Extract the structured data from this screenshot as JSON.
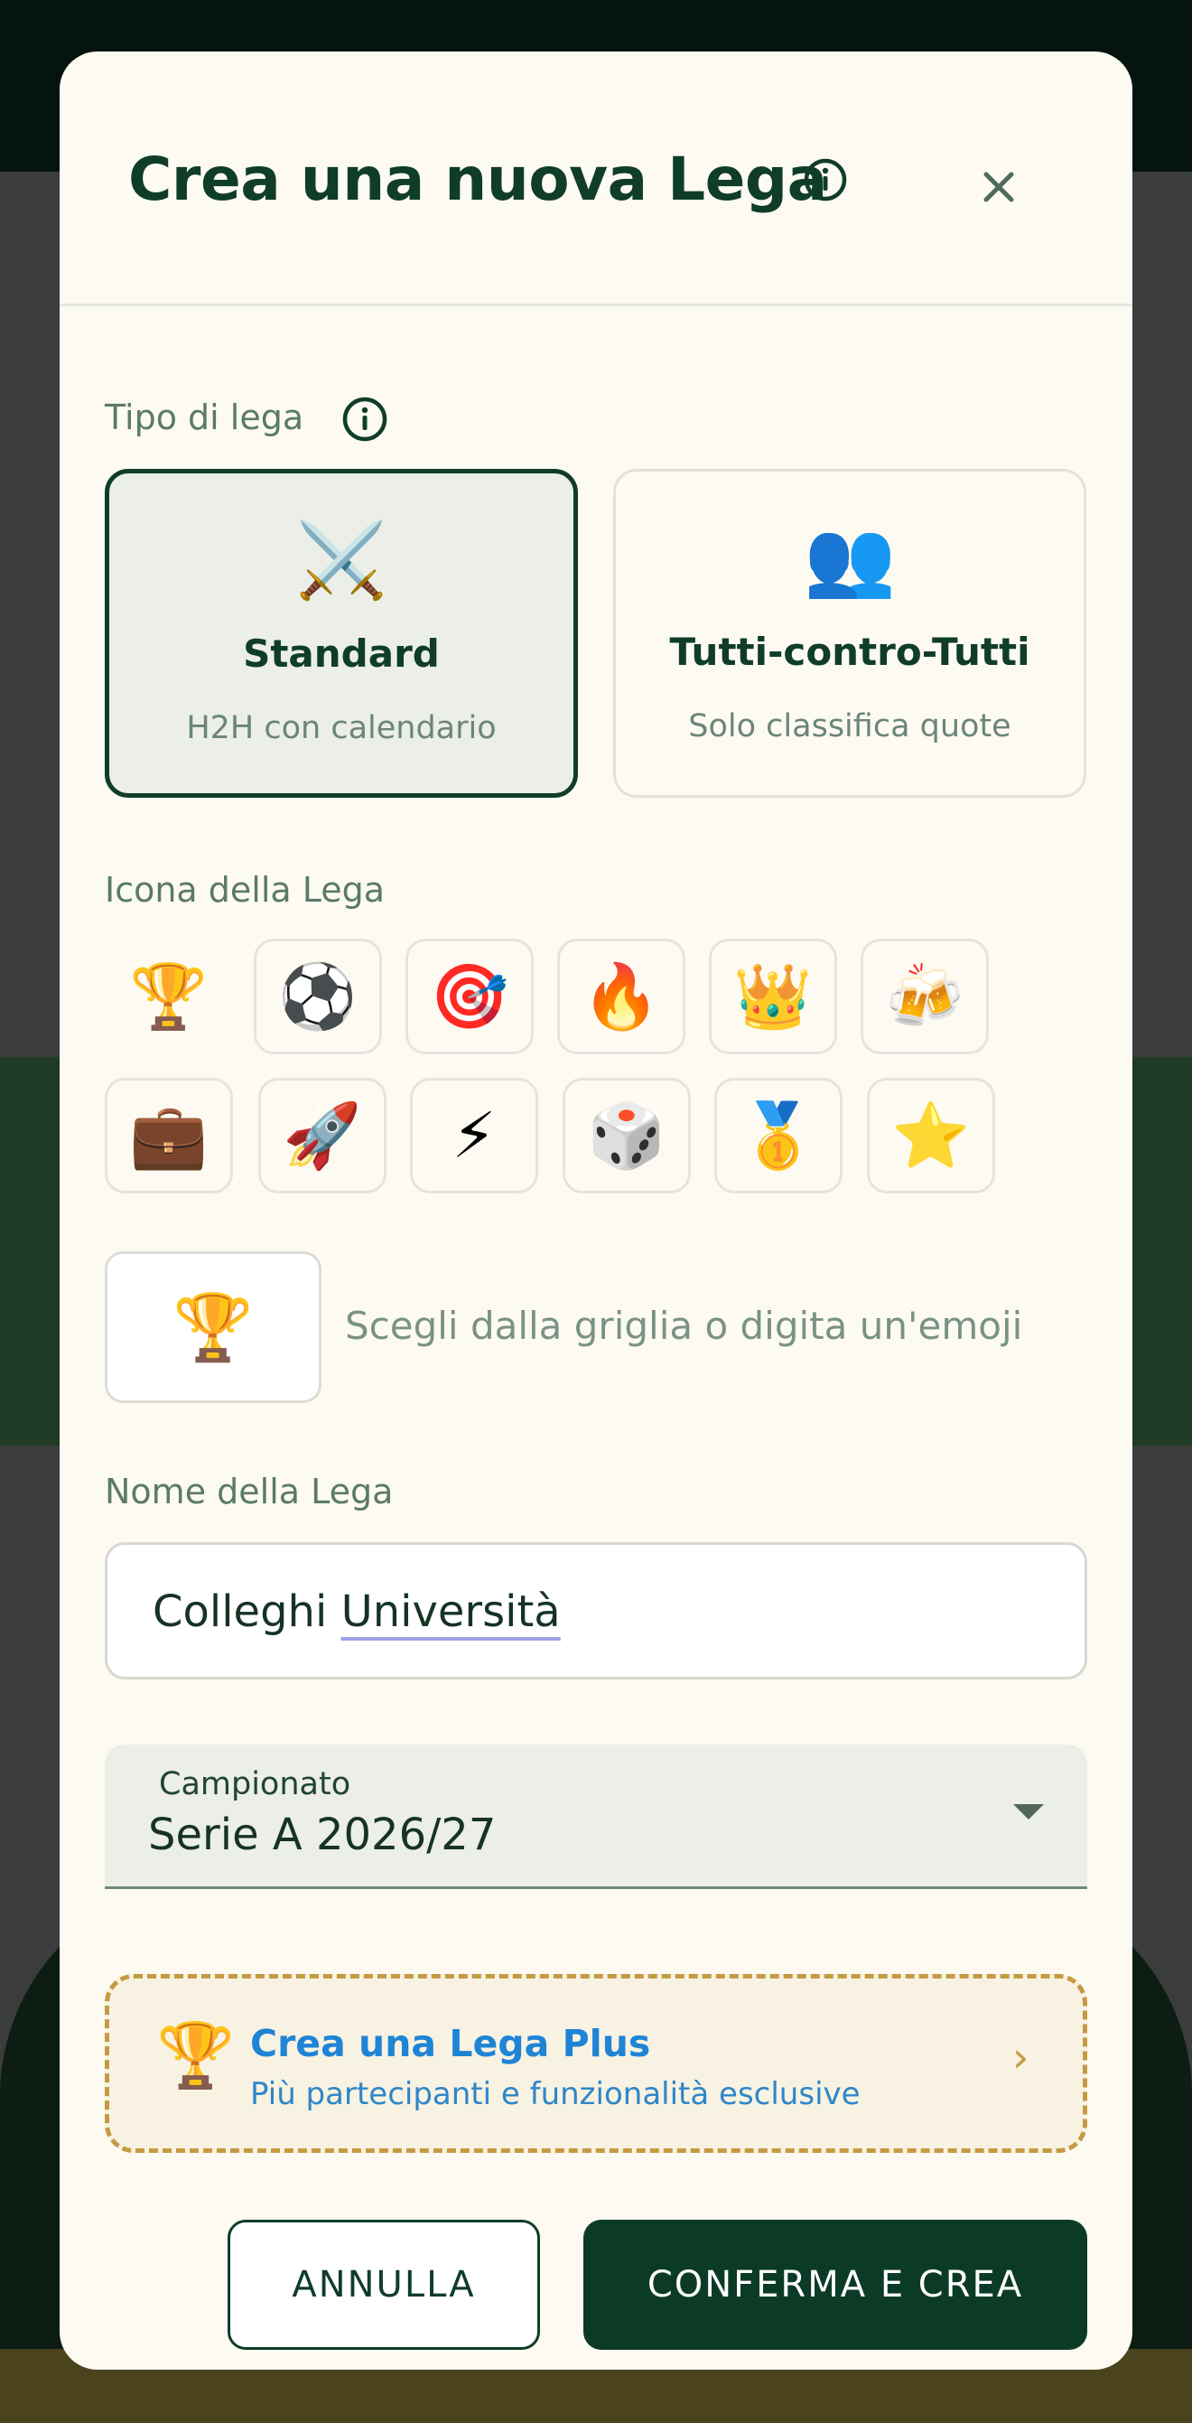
{
  "modal": {
    "title": "Crea una nuova Lega",
    "close_label": "×"
  },
  "league_type": {
    "label": "Tipo di lega",
    "options": [
      {
        "icon": "⚔️",
        "name": "Standard",
        "subtitle": "H2H con calendario",
        "selected": true
      },
      {
        "icon": "👥",
        "name": "Tutti-contro-Tutti",
        "subtitle": "Solo classifica quote",
        "selected": false
      }
    ]
  },
  "league_icon": {
    "label": "Icona della Lega",
    "grid": [
      "🏆",
      "⚽",
      "🎯",
      "🔥",
      "👑",
      "🍻",
      "💼",
      "🚀",
      "⚡",
      "🎲",
      "🥇",
      "⭐"
    ],
    "selected": "🏆",
    "custom_value": "🏆",
    "hint": "Scegli dalla griglia o digita un'emoji"
  },
  "league_name": {
    "label": "Nome della Lega",
    "value_part1": "Colleghi ",
    "value_part2": "Università"
  },
  "championship": {
    "label": "Campionato",
    "value": "Serie A 2026/27"
  },
  "plus_promo": {
    "icon": "🏆",
    "title": "Crea una Lega Plus",
    "subtitle": "Più partecipanti e funzionalità esclusive",
    "chevron": "›"
  },
  "actions": {
    "cancel": "ANNULLA",
    "confirm": "CONFERMA E CREA"
  },
  "colors": {
    "primary": "#0f3d2a",
    "accent_gold": "#c59a42",
    "link_blue": "#1f84d6",
    "background": "#fdfaf2"
  }
}
